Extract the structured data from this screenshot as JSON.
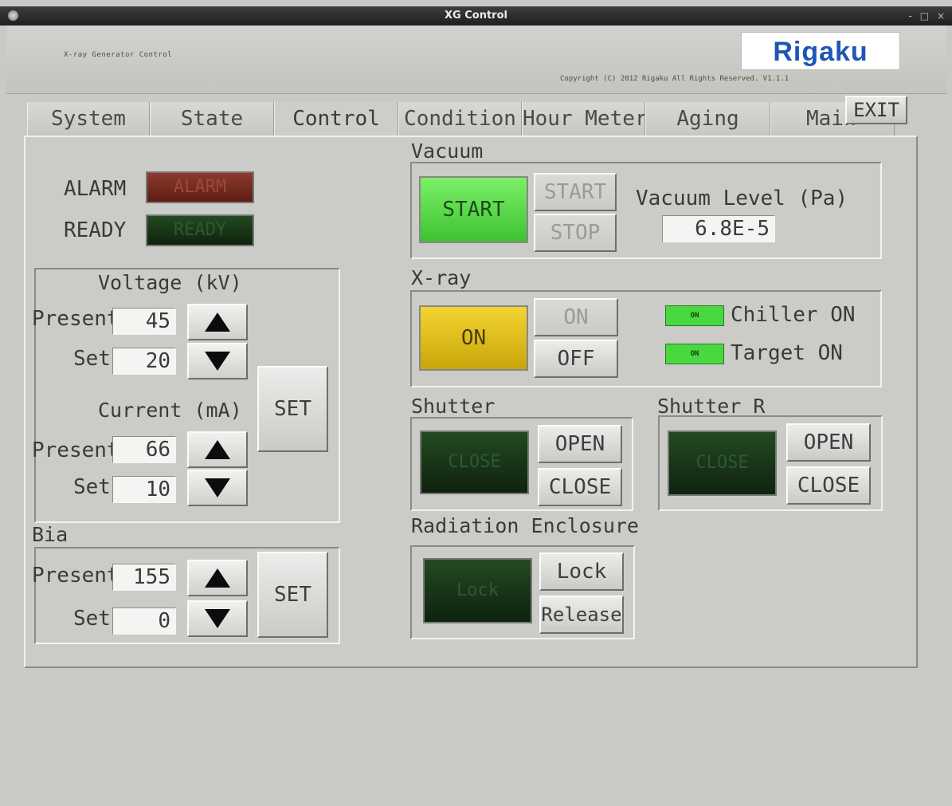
{
  "window": {
    "title": "XG Control",
    "controls": "- □ ×"
  },
  "header": {
    "subtitle": "X-ray Generator Control",
    "logo": "Rigaku",
    "copyright": "Copyright (C) 2012 Rigaku All Rights Reserved. V1.1.1"
  },
  "tabs": [
    {
      "label": "System"
    },
    {
      "label": "State"
    },
    {
      "label": "Control"
    },
    {
      "label": "Condition"
    },
    {
      "label": "Hour Meter"
    },
    {
      "label": "Aging"
    },
    {
      "label": "Main"
    }
  ],
  "exit_label": "EXIT",
  "status": {
    "alarm_label": "ALARM",
    "alarm_indicator": "ALARM",
    "ready_label": "READY",
    "ready_indicator": "READY"
  },
  "voltage": {
    "title": "Voltage (kV)",
    "present_label": "Present",
    "present": "45",
    "set_label": "Set",
    "set": "20"
  },
  "current": {
    "title": "Current (mA)",
    "present_label": "Present",
    "present": "66",
    "set_label": "Set",
    "set": "10"
  },
  "set_button": "SET",
  "bia": {
    "title": "Bia",
    "present_label": "Present",
    "present": "155",
    "set_label": "Set",
    "set": "0",
    "set_button": "SET"
  },
  "vacuum": {
    "title": "Vacuum",
    "indicator": "START",
    "start": "START",
    "stop": "STOP",
    "level_label": "Vacuum Level (Pa)",
    "level_value": "6.8E-5"
  },
  "xray": {
    "title": "X-ray",
    "indicator": "ON",
    "on": "ON",
    "off": "OFF",
    "chiller_led": "ON",
    "chiller_label": "Chiller ON",
    "target_led": "ON",
    "target_label": "Target ON"
  },
  "shutter": {
    "title": "Shutter",
    "indicator": "CLOSE",
    "open": "OPEN",
    "close": "CLOSE"
  },
  "shutter_r": {
    "title": "Shutter R",
    "indicator": "CLOSE",
    "open": "OPEN",
    "close": "CLOSE"
  },
  "enclosure": {
    "title": "Radiation Enclosure",
    "indicator": "Lock",
    "lock": "Lock",
    "release": "Release"
  }
}
